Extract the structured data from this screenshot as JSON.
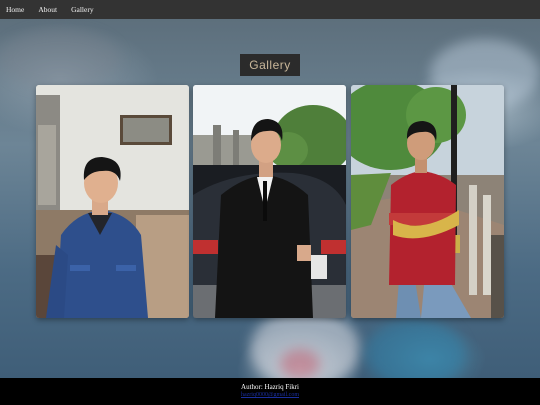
{
  "nav": {
    "items": [
      {
        "label": "Home"
      },
      {
        "label": "About"
      },
      {
        "label": "Gallery"
      }
    ]
  },
  "page": {
    "heading": "Gallery"
  },
  "gallery": {
    "photos": [
      {
        "name": "photo-denim-jacket"
      },
      {
        "name": "photo-suit-car"
      },
      {
        "name": "photo-red-jersey"
      }
    ]
  },
  "footer": {
    "author": "Author: Hazriq Fikri",
    "email": "hazriq0000@gmail.com"
  },
  "colors": {
    "navbar": "#333333",
    "footer": "#000000",
    "heading_bg": "#2b2b2b",
    "heading_text": "#c9b79a"
  }
}
